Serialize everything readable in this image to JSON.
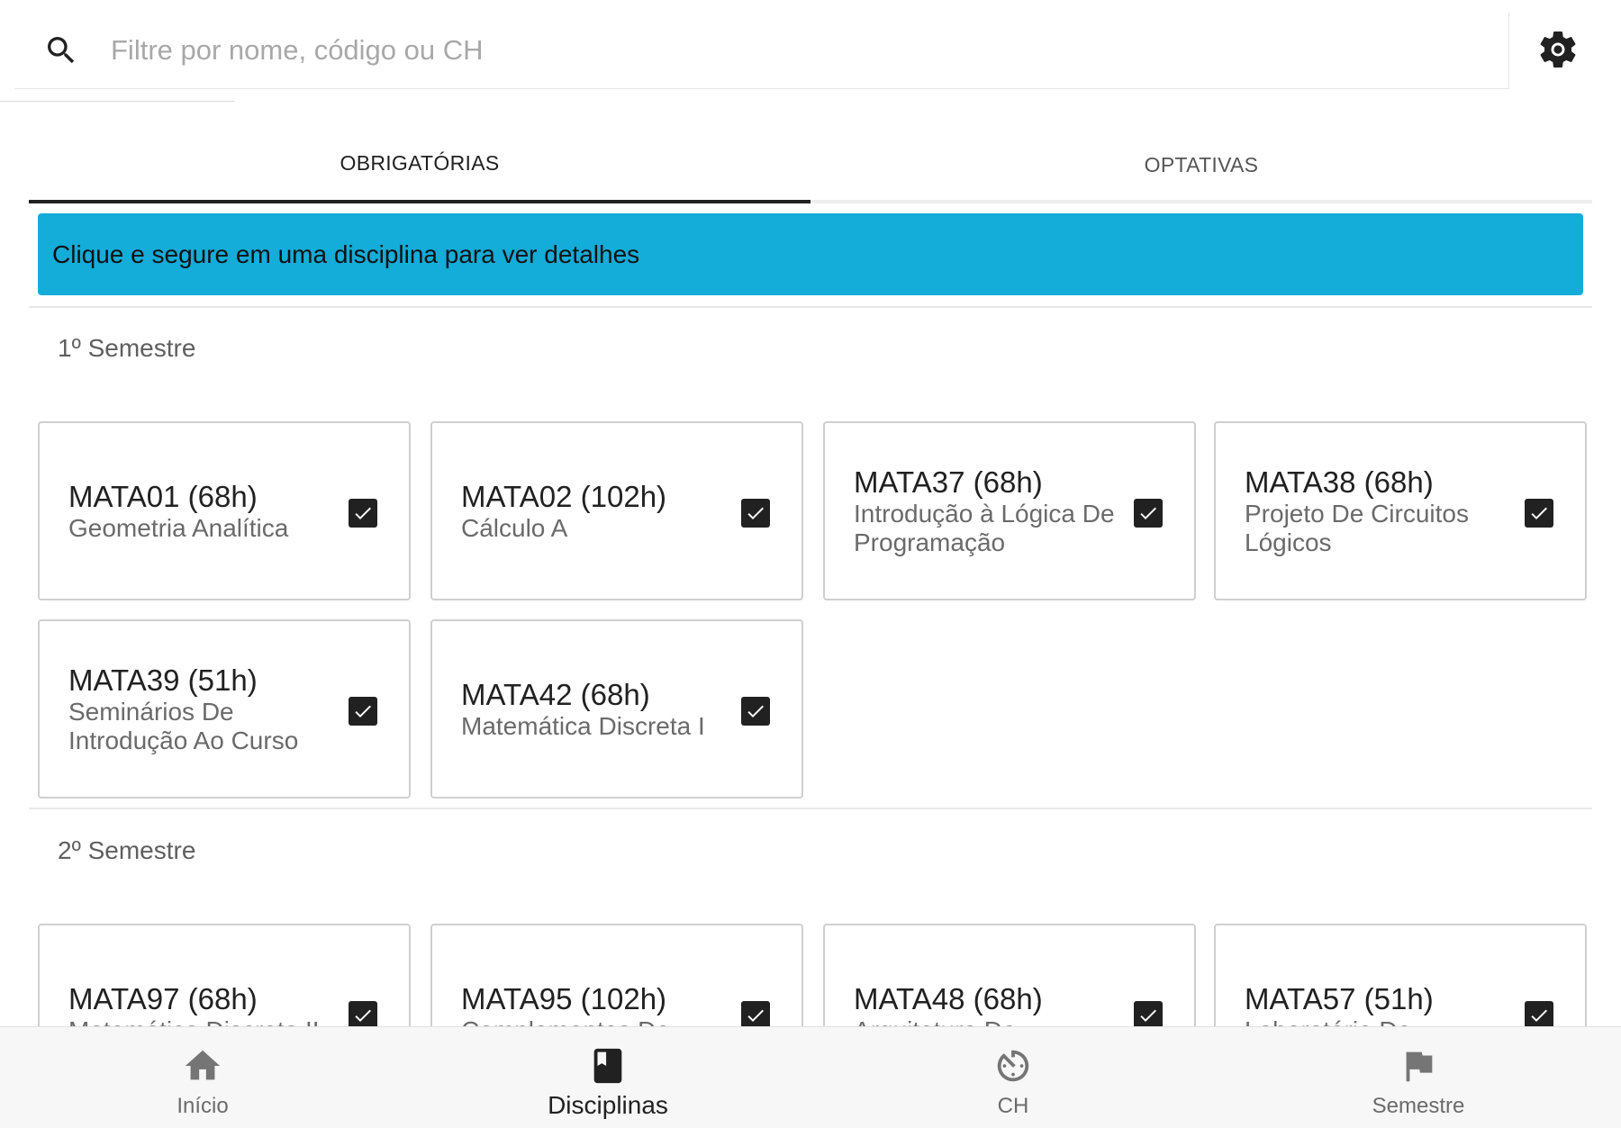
{
  "search": {
    "placeholder": "Filtre por nome, código ou CH",
    "value": ""
  },
  "tabs": [
    {
      "label": "OBRIGATÓRIAS",
      "active": true
    },
    {
      "label": "OPTATIVAS",
      "active": false
    }
  ],
  "banner": {
    "text": "Clique e segure em uma disciplina para ver detalhes",
    "color": "#14acd8"
  },
  "semesters": [
    {
      "title": "1º Semestre",
      "courses": [
        {
          "code": "MATA01 (68h)",
          "name": "Geometria Analítica",
          "checked": true
        },
        {
          "code": "MATA02 (102h)",
          "name": "Cálculo A",
          "checked": true
        },
        {
          "code": "MATA37 (68h)",
          "name": "Introdução à Lógica De Programação",
          "checked": true
        },
        {
          "code": "MATA38 (68h)",
          "name": "Projeto De Circuitos Lógicos",
          "checked": true
        },
        {
          "code": "MATA39 (51h)",
          "name": "Seminários De Introdução Ao Curso",
          "checked": true
        },
        {
          "code": "MATA42 (68h)",
          "name": "Matemática Discreta I",
          "checked": true
        }
      ]
    },
    {
      "title": "2º Semestre",
      "courses": [
        {
          "code": "MATA97 (68h)",
          "name": "Matemática Discreta II",
          "checked": true
        },
        {
          "code": "MATA95 (102h)",
          "name": "Complementos De",
          "checked": true
        },
        {
          "code": "MATA48 (68h)",
          "name": "Arquitetura De",
          "checked": true
        },
        {
          "code": "MATA57 (51h)",
          "name": "Laboratório De",
          "checked": true
        }
      ]
    }
  ],
  "bottom_nav": [
    {
      "label": "Início",
      "icon": "home-icon",
      "active": false
    },
    {
      "label": "Disciplinas",
      "icon": "book-icon",
      "active": true
    },
    {
      "label": "CH",
      "icon": "timer-icon",
      "active": false
    },
    {
      "label": "Semestre",
      "icon": "flag-icon",
      "active": false
    }
  ]
}
